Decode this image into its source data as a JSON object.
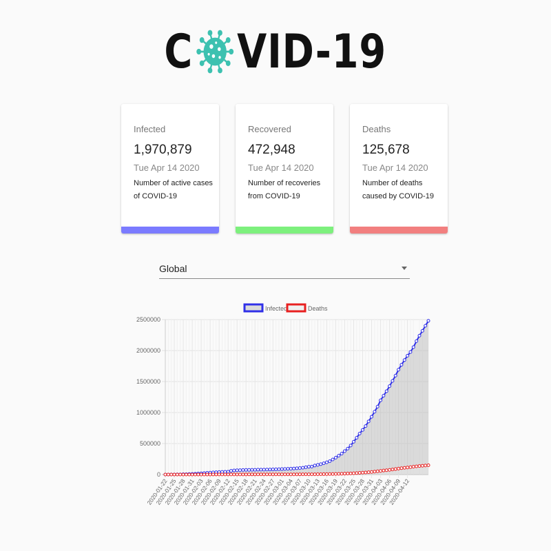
{
  "logo": {
    "text_left": "C",
    "text_right": "VID-19",
    "virus_color": "#3dc1b0"
  },
  "cards": [
    {
      "title": "Infected",
      "value": "1,970,879",
      "date": "Tue Apr 14 2020",
      "desc": "Number of active cases of COVID-19",
      "color": "#7b7bff"
    },
    {
      "title": "Recovered",
      "value": "472,948",
      "date": "Tue Apr 14 2020",
      "desc": "Number of recoveries from COVID-19",
      "color": "#7df07d"
    },
    {
      "title": "Deaths",
      "value": "125,678",
      "date": "Tue Apr 14 2020",
      "desc": "Number of deaths caused by COVID-19",
      "color": "#f27f7f"
    }
  ],
  "country_select": {
    "value": "Global"
  },
  "chart_data": {
    "type": "line",
    "legend_position": "top",
    "grid": true,
    "ylim": [
      0,
      2500000
    ],
    "yticks": [
      0,
      500000,
      1000000,
      1500000,
      2000000,
      2500000
    ],
    "ytick_labels": [
      "0",
      "500000",
      "1000000",
      "1500000",
      "2000000",
      "2500000"
    ],
    "x_start": "2020-01-22",
    "x_end": "2020-04-12",
    "xtick_labels": [
      "2020-01-22",
      "2020-01-25",
      "2020-01-28",
      "2020-01-31",
      "2020-02-03",
      "2020-02-06",
      "2020-02-09",
      "2020-02-12",
      "2020-02-15",
      "2020-02-18",
      "2020-02-21",
      "2020-02-24",
      "2020-02-27",
      "2020-03-01",
      "2020-03-04",
      "2020-03-07",
      "2020-03-10",
      "2020-03-13",
      "2020-03-16",
      "2020-03-19",
      "2020-03-22",
      "2020-03-25",
      "2020-03-28",
      "2020-03-31",
      "2020-04-03",
      "2020-04-06",
      "2020-04-09",
      "2020-04-12"
    ],
    "series": [
      {
        "name": "Infected",
        "color": "#3030e8",
        "fill": "rgba(180,180,180,0.45)",
        "values": [
          555,
          654,
          941,
          1434,
          2118,
          2927,
          5578,
          6166,
          8234,
          9927,
          12038,
          16787,
          19881,
          23892,
          27635,
          30794,
          34391,
          37120,
          40150,
          42762,
          44802,
          45221,
          60368,
          66885,
          69030,
          71224,
          73258,
          75136,
          75639,
          76197,
          76819,
          78572,
          78958,
          79561,
          80406,
          81388,
          82746,
          84112,
          86011,
          88369,
          90306,
          92840,
          95120,
          97886,
          101801,
          105847,
          109821,
          118592,
          125865,
          128343,
          145193,
          156097,
          167449,
          181546,
          197168,
          214915,
          242713,
          272167,
          304528,
          337020,
          378287,
          418041,
          467653,
          529591,
          593291,
          660706,
          720117,
          782365,
          857487,
          932605,
          1013466,
          1095917,
          1197405,
          1272115,
          1345101,
          1426096,
          1511104,
          1595350,
          1691719,
          1771514,
          1846680,
          1917320,
          1976191,
          2056055,
          2152437,
          2240191,
          2317758,
          2400000,
          2480000
        ]
      },
      {
        "name": "Deaths",
        "color": "#e82020",
        "fill": "rgba(230,230,230,0.5)",
        "values": [
          17,
          18,
          26,
          42,
          56,
          82,
          131,
          133,
          171,
          213,
          259,
          362,
          426,
          492,
          564,
          634,
          719,
          806,
          906,
          1013,
          1113,
          1118,
          1371,
          1523,
          1666,
          1770,
          1868,
          2007,
          2122,
          2247,
          2251,
          2458,
          2469,
          2629,
          2708,
          2770,
          2814,
          2872,
          2941,
          2996,
          3085,
          3160,
          3254,
          3348,
          3460,
          3558,
          3803,
          3996,
          4262,
          4615,
          4720,
          5404,
          5819,
          6440,
          7126,
          7905,
          8733,
          9867,
          11299,
          12973,
          14623,
          16497,
          18615,
          21181,
          23970,
          27198,
          30652,
          33925,
          37582,
          42107,
          46809,
          52983,
          58787,
          64606,
          69374,
          74565,
          81865,
          88338,
          95455,
          102525,
          108503,
          114091,
          119482,
          126000,
          132000,
          138000,
          142000,
          146000,
          150000
        ]
      }
    ]
  }
}
